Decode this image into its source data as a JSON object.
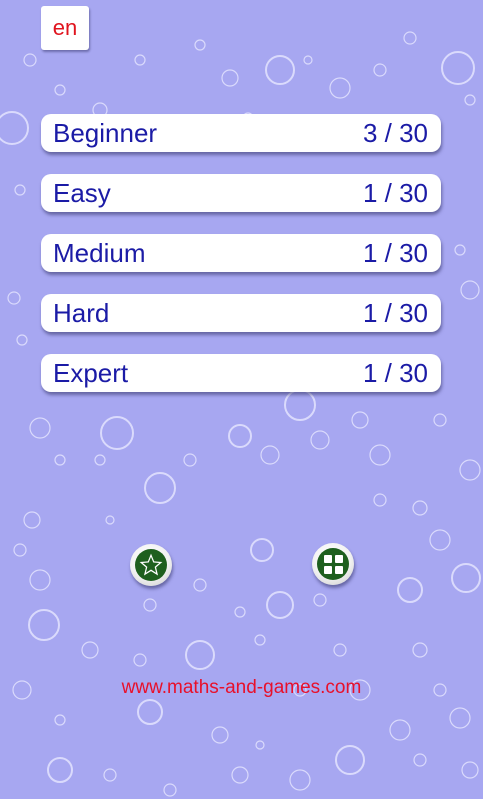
{
  "language_button": {
    "label": "en"
  },
  "levels": [
    {
      "name": "Beginner",
      "progress": "3 / 30"
    },
    {
      "name": "Easy",
      "progress": "1 / 30"
    },
    {
      "name": "Medium",
      "progress": "1 / 30"
    },
    {
      "name": "Hard",
      "progress": "1 / 30"
    },
    {
      "name": "Expert",
      "progress": "1 / 30"
    }
  ],
  "buttons": {
    "star": "star-icon",
    "menu": "grid-icon"
  },
  "footer": {
    "website": "www.maths-and-games.com"
  },
  "colors": {
    "background": "#a7a7f1",
    "level_text": "#1b1ba6",
    "accent_red": "#e0141e",
    "icon_green": "#1e5f1e"
  }
}
